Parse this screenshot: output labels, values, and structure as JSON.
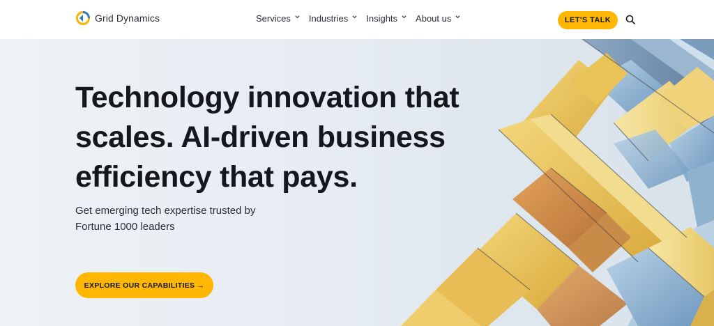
{
  "brand": {
    "name": "Grid Dynamics"
  },
  "nav": {
    "items": [
      {
        "label": "Services"
      },
      {
        "label": "Industries"
      },
      {
        "label": "Insights"
      },
      {
        "label": "About us"
      }
    ]
  },
  "header": {
    "cta_label": "LET'S TALK"
  },
  "hero": {
    "headline_lines": [
      "Technology innovation that",
      "scales. AI-driven business",
      "efficiency that pays."
    ],
    "subline_lines": [
      "Get emerging tech expertise trusted by",
      "Fortune 1000 leaders"
    ],
    "cta_label": "EXPLORE OUR CAPABILITIES →"
  },
  "icons": {
    "logo": "grid-dynamics-logo-icon",
    "nav_chevron": "chevron-down-icon",
    "search": "search-icon"
  },
  "colors": {
    "accent": "#ffb703",
    "text": "#15171c",
    "hero_background": "#e6ecf2"
  }
}
